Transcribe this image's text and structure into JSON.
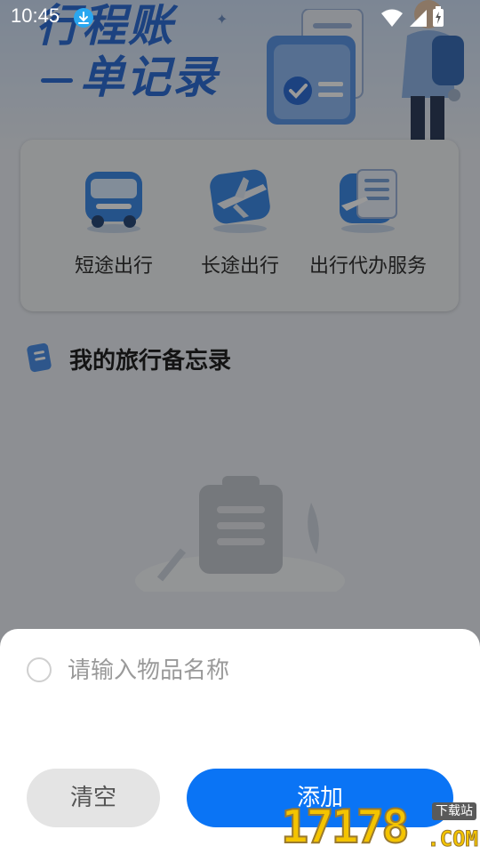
{
  "status_bar": {
    "time": "10:45",
    "icons": [
      "download-icon",
      "wifi-icon",
      "signal-icon",
      "battery-icon"
    ]
  },
  "hero": {
    "title_line1": "行程账",
    "title_line2": "单记录"
  },
  "services": [
    {
      "label": "短途出行",
      "icon": "bus-icon"
    },
    {
      "label": "长途出行",
      "icon": "airplane-icon"
    },
    {
      "label": "出行代办服务",
      "icon": "document-plane-icon"
    }
  ],
  "memo": {
    "title": "我的旅行备忘录",
    "icon": "memo-icon",
    "empty_icon": "empty-clipboard-icon"
  },
  "sheet": {
    "input_placeholder": "请输入物品名称",
    "input_value": "",
    "clear_label": "清空",
    "add_label": "添加"
  },
  "watermark": {
    "number": "17178",
    "badge": "下载站",
    "domain": ".COM"
  },
  "colors": {
    "accent": "#0a74f5",
    "hero_title": "#2f6fd6",
    "clear_bg": "#e4e4e4",
    "watermark": "#f4c400"
  }
}
